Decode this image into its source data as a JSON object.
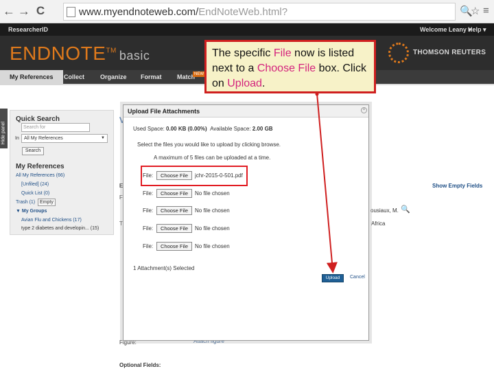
{
  "browser": {
    "back_glyph": "←",
    "forward_glyph": "→",
    "reload_glyph": "C",
    "url_main": "www.myendnoteweb.com/",
    "url_path": "EndNoteWeb.html?",
    "zoom_glyph": "🔍",
    "star_glyph": "☆",
    "menu_glyph": "≡"
  },
  "topnav": {
    "researcherid": "ResearcherID",
    "welcome": "Welcome Leany ▾",
    "help": "Help ▾"
  },
  "header": {
    "logo_main": "ENDNOTE",
    "logo_tm": "TM",
    "logo_sub": "basic",
    "partner": "THOMSON REUTERS"
  },
  "tabs": [
    {
      "label": "My References"
    },
    {
      "label": "Collect"
    },
    {
      "label": "Organize"
    },
    {
      "label": "Format"
    },
    {
      "label": "Match"
    }
  ],
  "new_badge": "NEW",
  "hide_panel": "Hide panel",
  "sidebar": {
    "quick_search_title": "Quick Search",
    "search_placeholder": "Search for",
    "in_label": "In",
    "scope_value": "All My References",
    "search_button": "Search",
    "my_references_title": "My References",
    "all_refs": "All My References (66)",
    "unfiled": "[Unfiled] (24)",
    "quick_list": "Quick List (0)",
    "trash": "Trash (1)",
    "empty": "Empty",
    "my_groups": "▼ My Groups",
    "group1": "Avian Flu and Chickens (17)",
    "group2": "type 2 diabetes and developin... (15)"
  },
  "background": {
    "v_glyph": "V",
    "e_glyph": "E",
    "f_glyph": "F",
    "t_glyph": "T",
    "show_empty_fields": "Show Empty Fields",
    "author_fragment": "ousiaux, M.",
    "africa": "Africa",
    "figure_label": "Figure:",
    "attach_figure": "Attach figure",
    "optional_fields": "Optional Fields:"
  },
  "dialog": {
    "title": "Upload File Attachments",
    "used_space_label": "Used Space:",
    "used_space_value": "0.00 KB (0.00%)",
    "available_space_label": "Available Space:",
    "available_space_value": "2.00 GB",
    "instruction": "Select the files you would like to upload by clicking browse.",
    "max_note": "A maximum of 5 files can be uploaded at a time.",
    "file_label": "File:",
    "choose_button": "Choose File",
    "files": [
      {
        "name": "jchr-2015-0-501.pdf"
      },
      {
        "name": "No file chosen"
      },
      {
        "name": "No file chosen"
      },
      {
        "name": "No file chosen"
      },
      {
        "name": "No file chosen"
      }
    ],
    "selected_count": "1 Attachment(s) Selected",
    "upload_button": "Upload",
    "cancel_link": "Cancel"
  },
  "callout": {
    "part1": "The specific ",
    "file_word": "File",
    "part2": " now is listed next to a ",
    "choose_word": "Choose File",
    "part3": " box.  Click on ",
    "upload_word": "Upload",
    "part4": "."
  },
  "colors": {
    "accent_orange": "#e07a1c",
    "callout_border": "#cf1f1f",
    "callout_accent": "#d4237d",
    "link_blue": "#1f4f86",
    "upload_button": "#1f5f95"
  }
}
